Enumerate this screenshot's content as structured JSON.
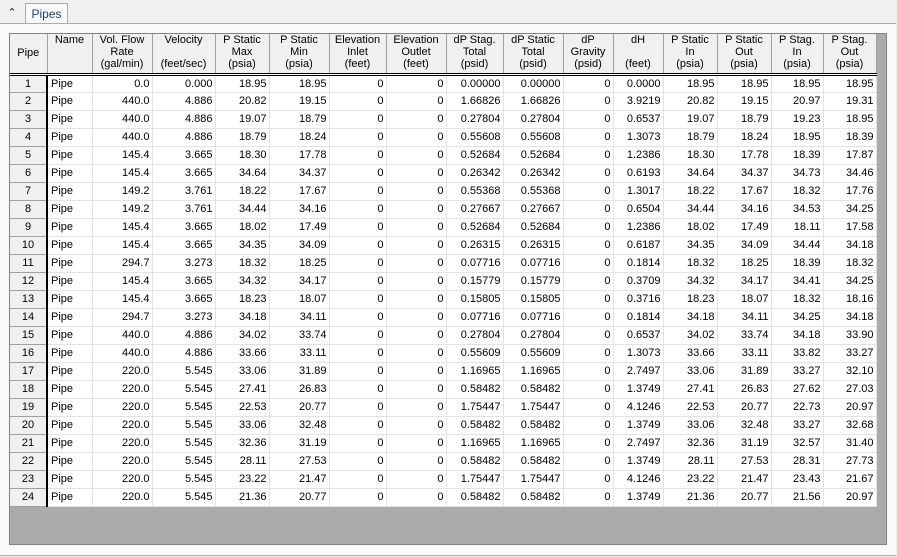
{
  "tabstrip": {
    "collapse_icon": "⌃",
    "tabs": [
      {
        "label": "Pipes",
        "active": true
      }
    ]
  },
  "table": {
    "columns": [
      {
        "key": "pipe",
        "lines": [
          "Pipe"
        ]
      },
      {
        "key": "name",
        "lines": [
          "Name",
          "",
          ""
        ]
      },
      {
        "key": "flow",
        "lines": [
          "Vol. Flow",
          "Rate",
          "(gal/min)"
        ]
      },
      {
        "key": "velocity",
        "lines": [
          "Velocity",
          "",
          "(feet/sec)"
        ]
      },
      {
        "key": "ps_max",
        "lines": [
          "P Static",
          "Max",
          "(psia)"
        ]
      },
      {
        "key": "ps_min",
        "lines": [
          "P Static",
          "Min",
          "(psia)"
        ]
      },
      {
        "key": "elev_in",
        "lines": [
          "Elevation",
          "Inlet",
          "(feet)"
        ]
      },
      {
        "key": "elev_out",
        "lines": [
          "Elevation",
          "Outlet",
          "(feet)"
        ]
      },
      {
        "key": "dp_stag",
        "lines": [
          "dP Stag.",
          "Total",
          "(psid)"
        ]
      },
      {
        "key": "dp_static",
        "lines": [
          "dP Static",
          "Total",
          "(psid)"
        ]
      },
      {
        "key": "dp_grav",
        "lines": [
          "dP",
          "Gravity",
          "(psid)"
        ]
      },
      {
        "key": "dh",
        "lines": [
          "dH",
          "",
          "(feet)"
        ]
      },
      {
        "key": "ps_in",
        "lines": [
          "P Static",
          "In",
          "(psia)"
        ]
      },
      {
        "key": "ps_out",
        "lines": [
          "P Static",
          "Out",
          "(psia)"
        ]
      },
      {
        "key": "pst_in",
        "lines": [
          "P Stag.",
          "In",
          "(psia)"
        ]
      },
      {
        "key": "pst_out",
        "lines": [
          "P Stag.",
          "Out",
          "(psia)"
        ]
      }
    ],
    "rows": [
      [
        "1",
        "Pipe",
        "0.0",
        "0.000",
        "18.95",
        "18.95",
        "0",
        "0",
        "0.00000",
        "0.00000",
        "0",
        "0.0000",
        "18.95",
        "18.95",
        "18.95",
        "18.95"
      ],
      [
        "2",
        "Pipe",
        "440.0",
        "4.886",
        "20.82",
        "19.15",
        "0",
        "0",
        "1.66826",
        "1.66826",
        "0",
        "3.9219",
        "20.82",
        "19.15",
        "20.97",
        "19.31"
      ],
      [
        "3",
        "Pipe",
        "440.0",
        "4.886",
        "19.07",
        "18.79",
        "0",
        "0",
        "0.27804",
        "0.27804",
        "0",
        "0.6537",
        "19.07",
        "18.79",
        "19.23",
        "18.95"
      ],
      [
        "4",
        "Pipe",
        "440.0",
        "4.886",
        "18.79",
        "18.24",
        "0",
        "0",
        "0.55608",
        "0.55608",
        "0",
        "1.3073",
        "18.79",
        "18.24",
        "18.95",
        "18.39"
      ],
      [
        "5",
        "Pipe",
        "145.4",
        "3.665",
        "18.30",
        "17.78",
        "0",
        "0",
        "0.52684",
        "0.52684",
        "0",
        "1.2386",
        "18.30",
        "17.78",
        "18.39",
        "17.87"
      ],
      [
        "6",
        "Pipe",
        "145.4",
        "3.665",
        "34.64",
        "34.37",
        "0",
        "0",
        "0.26342",
        "0.26342",
        "0",
        "0.6193",
        "34.64",
        "34.37",
        "34.73",
        "34.46"
      ],
      [
        "7",
        "Pipe",
        "149.2",
        "3.761",
        "18.22",
        "17.67",
        "0",
        "0",
        "0.55368",
        "0.55368",
        "0",
        "1.3017",
        "18.22",
        "17.67",
        "18.32",
        "17.76"
      ],
      [
        "8",
        "Pipe",
        "149.2",
        "3.761",
        "34.44",
        "34.16",
        "0",
        "0",
        "0.27667",
        "0.27667",
        "0",
        "0.6504",
        "34.44",
        "34.16",
        "34.53",
        "34.25"
      ],
      [
        "9",
        "Pipe",
        "145.4",
        "3.665",
        "18.02",
        "17.49",
        "0",
        "0",
        "0.52684",
        "0.52684",
        "0",
        "1.2386",
        "18.02",
        "17.49",
        "18.11",
        "17.58"
      ],
      [
        "10",
        "Pipe",
        "145.4",
        "3.665",
        "34.35",
        "34.09",
        "0",
        "0",
        "0.26315",
        "0.26315",
        "0",
        "0.6187",
        "34.35",
        "34.09",
        "34.44",
        "34.18"
      ],
      [
        "11",
        "Pipe",
        "294.7",
        "3.273",
        "18.32",
        "18.25",
        "0",
        "0",
        "0.07716",
        "0.07716",
        "0",
        "0.1814",
        "18.32",
        "18.25",
        "18.39",
        "18.32"
      ],
      [
        "12",
        "Pipe",
        "145.4",
        "3.665",
        "34.32",
        "34.17",
        "0",
        "0",
        "0.15779",
        "0.15779",
        "0",
        "0.3709",
        "34.32",
        "34.17",
        "34.41",
        "34.25"
      ],
      [
        "13",
        "Pipe",
        "145.4",
        "3.665",
        "18.23",
        "18.07",
        "0",
        "0",
        "0.15805",
        "0.15805",
        "0",
        "0.3716",
        "18.23",
        "18.07",
        "18.32",
        "18.16"
      ],
      [
        "14",
        "Pipe",
        "294.7",
        "3.273",
        "34.18",
        "34.11",
        "0",
        "0",
        "0.07716",
        "0.07716",
        "0",
        "0.1814",
        "34.18",
        "34.11",
        "34.25",
        "34.18"
      ],
      [
        "15",
        "Pipe",
        "440.0",
        "4.886",
        "34.02",
        "33.74",
        "0",
        "0",
        "0.27804",
        "0.27804",
        "0",
        "0.6537",
        "34.02",
        "33.74",
        "34.18",
        "33.90"
      ],
      [
        "16",
        "Pipe",
        "440.0",
        "4.886",
        "33.66",
        "33.11",
        "0",
        "0",
        "0.55609",
        "0.55609",
        "0",
        "1.3073",
        "33.66",
        "33.11",
        "33.82",
        "33.27"
      ],
      [
        "17",
        "Pipe",
        "220.0",
        "5.545",
        "33.06",
        "31.89",
        "0",
        "0",
        "1.16965",
        "1.16965",
        "0",
        "2.7497",
        "33.06",
        "31.89",
        "33.27",
        "32.10"
      ],
      [
        "18",
        "Pipe",
        "220.0",
        "5.545",
        "27.41",
        "26.83",
        "0",
        "0",
        "0.58482",
        "0.58482",
        "0",
        "1.3749",
        "27.41",
        "26.83",
        "27.62",
        "27.03"
      ],
      [
        "19",
        "Pipe",
        "220.0",
        "5.545",
        "22.53",
        "20.77",
        "0",
        "0",
        "1.75447",
        "1.75447",
        "0",
        "4.1246",
        "22.53",
        "20.77",
        "22.73",
        "20.97"
      ],
      [
        "20",
        "Pipe",
        "220.0",
        "5.545",
        "33.06",
        "32.48",
        "0",
        "0",
        "0.58482",
        "0.58482",
        "0",
        "1.3749",
        "33.06",
        "32.48",
        "33.27",
        "32.68"
      ],
      [
        "21",
        "Pipe",
        "220.0",
        "5.545",
        "32.36",
        "31.19",
        "0",
        "0",
        "1.16965",
        "1.16965",
        "0",
        "2.7497",
        "32.36",
        "31.19",
        "32.57",
        "31.40"
      ],
      [
        "22",
        "Pipe",
        "220.0",
        "5.545",
        "28.11",
        "27.53",
        "0",
        "0",
        "0.58482",
        "0.58482",
        "0",
        "1.3749",
        "28.11",
        "27.53",
        "28.31",
        "27.73"
      ],
      [
        "23",
        "Pipe",
        "220.0",
        "5.545",
        "23.22",
        "21.47",
        "0",
        "0",
        "1.75447",
        "1.75447",
        "0",
        "4.1246",
        "23.22",
        "21.47",
        "23.43",
        "21.67"
      ],
      [
        "24",
        "Pipe",
        "220.0",
        "5.545",
        "21.36",
        "20.77",
        "0",
        "0",
        "0.58482",
        "0.58482",
        "0",
        "1.3749",
        "21.36",
        "20.77",
        "21.56",
        "20.97"
      ]
    ]
  }
}
